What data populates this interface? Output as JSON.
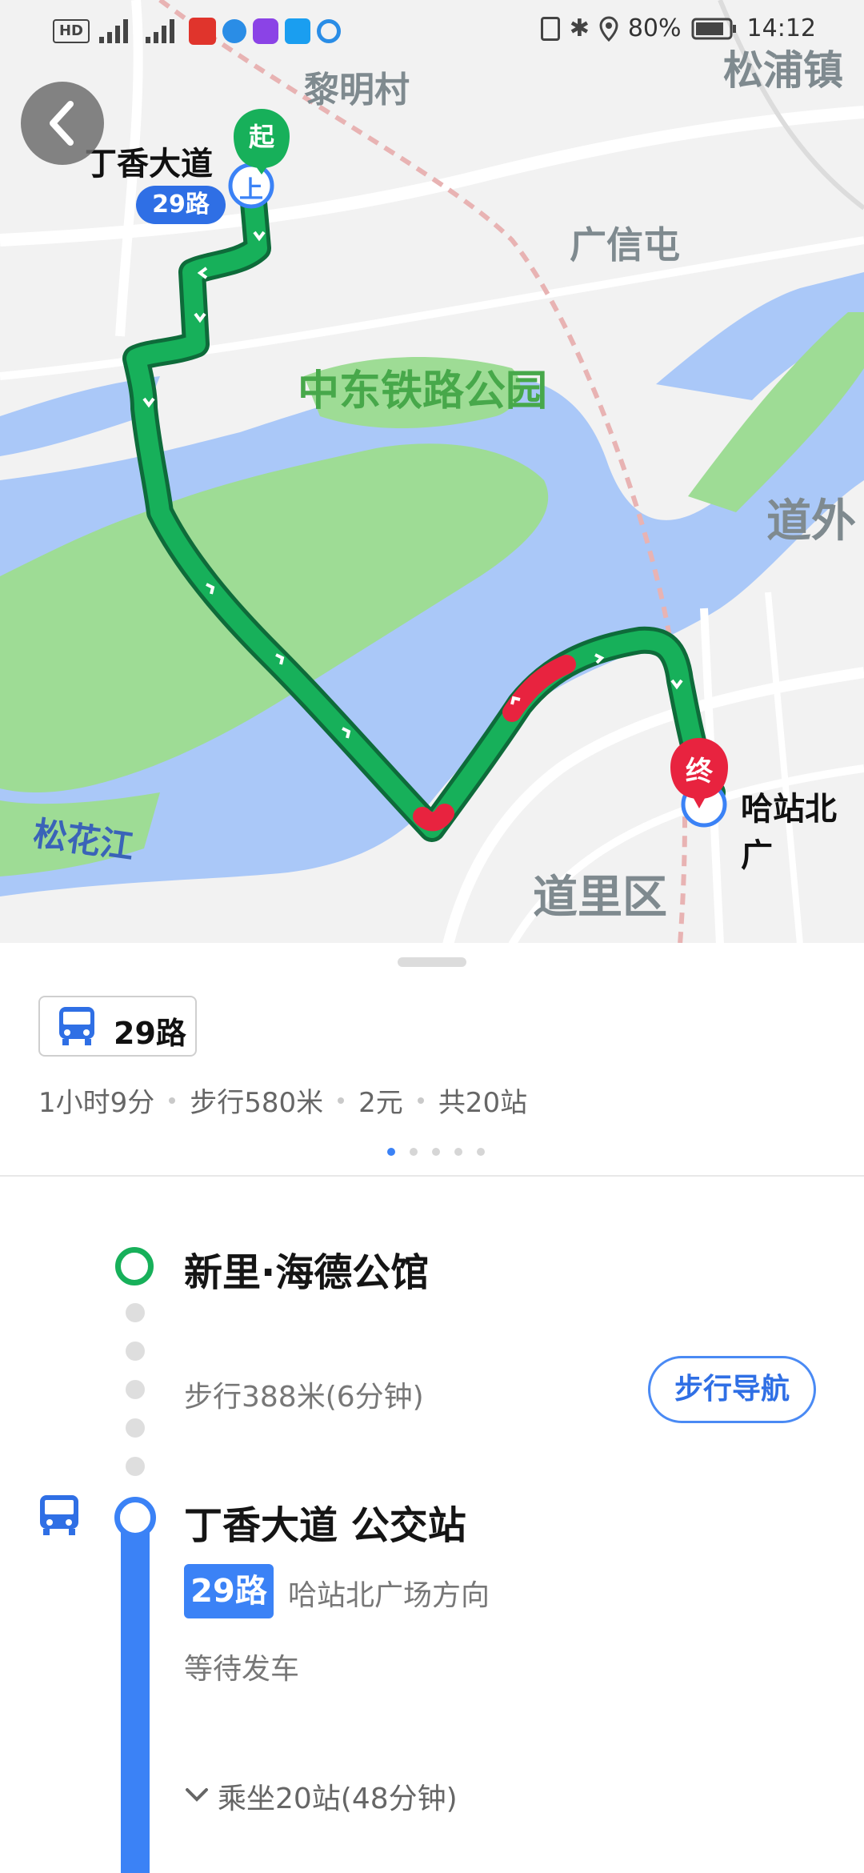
{
  "status_bar": {
    "left_icons": [
      "hd-icon",
      "signal-4g-icon",
      "signal-4g-icon",
      "mic-icon",
      "app-icon",
      "video-app-icon",
      "alipay-icon",
      "search-app-icon"
    ],
    "battery": "80%",
    "time": "14:12"
  },
  "map": {
    "places": [
      "黎明村",
      "松浦镇",
      "广信屯",
      "中东铁路公园",
      "道外",
      "松花江",
      "道里区"
    ],
    "start_stop": "丁香大道",
    "start_route": "29路",
    "start_marker": "起",
    "board_marker": "上",
    "end_marker": "终",
    "end_stop": "哈站北广",
    "colors": {
      "water": "#aac8f8",
      "park": "#9edc95",
      "route": "#17b05a",
      "congestion": "#e8233f",
      "land": "#f2f2f2"
    }
  },
  "sheet": {
    "route_chip": "29路",
    "summary": [
      "1小时9分",
      "步行580米",
      "2元",
      "共20站"
    ],
    "pager_count": 5,
    "pager_active": 0,
    "steps": {
      "origin": "新里·海德公馆",
      "walk": "步行388米(6分钟)",
      "walk_nav": "步行导航",
      "stop": "丁香大道 公交站",
      "line": "29路",
      "direction": "哈站北广场方向",
      "wait": "等待发车",
      "ride": "乘坐20站(48分钟)"
    }
  }
}
